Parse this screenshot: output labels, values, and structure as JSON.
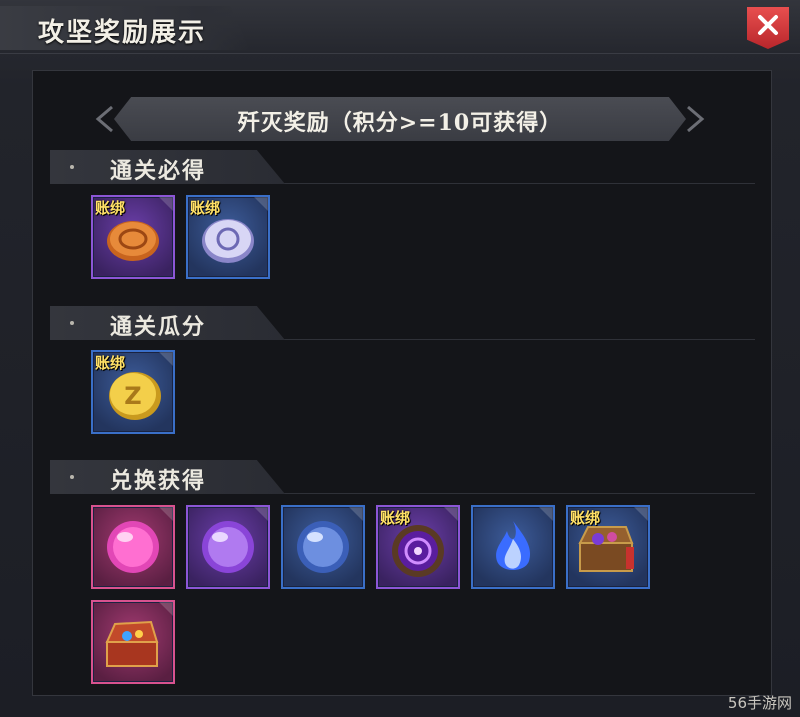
{
  "window": {
    "title": "攻坚奖励展示",
    "close_icon": "close-icon"
  },
  "banner": {
    "text": "歼灭奖励（积分>=10可获得）"
  },
  "sections": [
    {
      "label": "通关必得",
      "items": [
        {
          "icon": "bronze-coin-icon",
          "tag": "账绑",
          "rarity": "purple"
        },
        {
          "icon": "silver-coin-icon",
          "tag": "账绑",
          "rarity": "blue"
        }
      ]
    },
    {
      "label": "通关瓜分",
      "items": [
        {
          "icon": "gold-coin-icon",
          "tag": "账绑",
          "rarity": "blue"
        }
      ]
    },
    {
      "label": "兑换获得",
      "items": [
        {
          "icon": "pink-orb-icon",
          "tag": "",
          "rarity": "pink"
        },
        {
          "icon": "purple-orb-icon",
          "tag": "",
          "rarity": "purple"
        },
        {
          "icon": "blue-orb-icon",
          "tag": "",
          "rarity": "blue"
        },
        {
          "icon": "purple-rune-icon",
          "tag": "账绑",
          "rarity": "purple"
        },
        {
          "icon": "blue-flame-icon",
          "tag": "",
          "rarity": "blue"
        },
        {
          "icon": "treasure-chest-icon",
          "tag": "账绑",
          "rarity": "blue"
        },
        {
          "icon": "red-chest-icon",
          "tag": "",
          "rarity": "pink"
        }
      ]
    }
  ],
  "watermark": "56手游网"
}
